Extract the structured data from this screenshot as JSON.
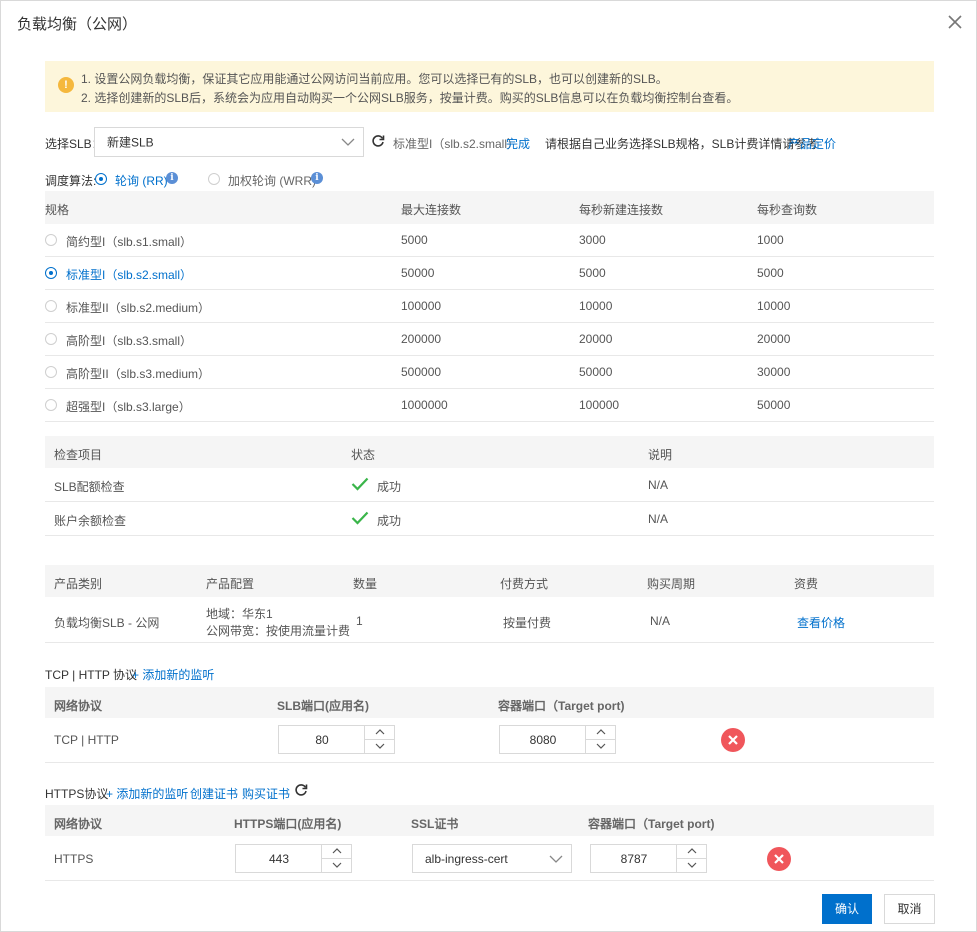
{
  "dialog": {
    "title": "负载均衡（公网）"
  },
  "notice": {
    "line1": "1. 设置公网负载均衡，保证其它应用能通过公网访问当前应用。您可以选择已有的SLB，也可以创建新的SLB。",
    "line2": "2. 选择创建新的SLB后，系统会为应用自动购买一个公网SLB服务，按量计费。购买的SLB信息可以在负载均衡控制台查看。"
  },
  "slb_select": {
    "label": "选择SLB：",
    "value": "新建SLB",
    "spec_text": "标准型I（slb.s2.small）",
    "done": "完成",
    "hint": "请根据自己业务选择SLB规格，SLB计费详情请参考",
    "pricing_link": "产品定价"
  },
  "algorithm": {
    "label": "调度算法:",
    "options": [
      {
        "label": "轮询 (RR)",
        "selected": true
      },
      {
        "label": "加权轮询 (WRR)",
        "selected": false
      }
    ]
  },
  "spec_table": {
    "headers": [
      "规格",
      "最大连接数",
      "每秒新建连接数",
      "每秒查询数"
    ],
    "rows": [
      {
        "name": "简约型I（slb.s1.small）",
        "max_conn": "5000",
        "new_conn": "3000",
        "qps": "1000",
        "selected": false
      },
      {
        "name": "标准型I（slb.s2.small）",
        "max_conn": "50000",
        "new_conn": "5000",
        "qps": "5000",
        "selected": true
      },
      {
        "name": "标准型II（slb.s2.medium）",
        "max_conn": "100000",
        "new_conn": "10000",
        "qps": "10000",
        "selected": false
      },
      {
        "name": "高阶型I（slb.s3.small）",
        "max_conn": "200000",
        "new_conn": "20000",
        "qps": "20000",
        "selected": false
      },
      {
        "name": "高阶型II（slb.s3.medium）",
        "max_conn": "500000",
        "new_conn": "50000",
        "qps": "30000",
        "selected": false
      },
      {
        "name": "超强型I（slb.s3.large）",
        "max_conn": "1000000",
        "new_conn": "100000",
        "qps": "50000",
        "selected": false
      }
    ]
  },
  "check_table": {
    "headers": [
      "检查项目",
      "状态",
      "说明"
    ],
    "rows": [
      {
        "item": "SLB配额检查",
        "status": "成功",
        "note": "N/A"
      },
      {
        "item": "账户余额检查",
        "status": "成功",
        "note": "N/A"
      }
    ]
  },
  "product_table": {
    "headers": [
      "产品类别",
      "产品配置",
      "数量",
      "付费方式",
      "购买周期",
      "资费"
    ],
    "row": {
      "category": "负载均衡SLB - 公网",
      "config_line1": "地域：华东1",
      "config_line2": "公网带宽：按使用流量计费",
      "quantity": "1",
      "billing": "按量付费",
      "period": "N/A",
      "price_link": "查看价格"
    }
  },
  "tcp_section": {
    "title": "TCP | HTTP 协议",
    "add_link": "+ 添加新的监听",
    "headers": [
      "网络协议",
      "SLB端口(应用名)",
      "容器端口（Target port)"
    ],
    "row": {
      "protocol": "TCP | HTTP",
      "slb_port": "80",
      "target_port": "8080"
    }
  },
  "https_section": {
    "title": "HTTPS协议",
    "add_link": "+ 添加新的监听",
    "create_cert": "创建证书",
    "buy_cert": "购买证书",
    "headers": [
      "网络协议",
      "HTTPS端口(应用名)",
      "SSL证书",
      "容器端口（Target port)"
    ],
    "row": {
      "protocol": "HTTPS",
      "https_port": "443",
      "ssl_cert": "alb-ingress-cert",
      "target_port": "8787"
    }
  },
  "footer": {
    "confirm": "确认",
    "cancel": "取消"
  },
  "colors": {
    "accent": "#0070cc",
    "warning_bg": "#fdf6db",
    "success": "#3ab54a",
    "danger": "#f0565b"
  }
}
